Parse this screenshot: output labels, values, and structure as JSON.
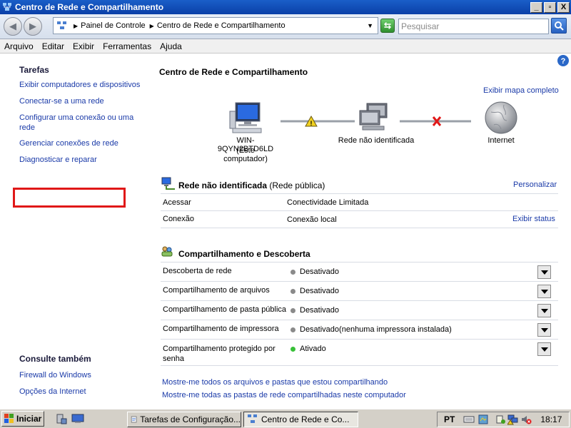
{
  "window": {
    "title": "Centro de Rede e Compartilhamento",
    "minimize": "_",
    "maximize": "▫",
    "close": "X"
  },
  "address": {
    "crumbs": [
      "Painel de Controle",
      "Centro de Rede e Compartilhamento"
    ],
    "search_placeholder": "Pesquisar"
  },
  "menu": [
    "Arquivo",
    "Editar",
    "Exibir",
    "Ferramentas",
    "Ajuda"
  ],
  "left": {
    "tasks_heading": "Tarefas",
    "tasks": [
      "Exibir computadores e dispositivos",
      "Conectar-se a uma rede",
      "Configurar uma conexão ou uma rede",
      "Gerenciar conexões de rede",
      "Diagnosticar e reparar"
    ],
    "see_also_heading": "Consulte também",
    "see_also": [
      "Firewall do Windows",
      "Opções da Internet"
    ]
  },
  "main": {
    "title": "Centro de Rede e Compartilhamento",
    "full_map_link": "Exibir mapa completo",
    "map": {
      "computer_name": "WIN-9QYN2BTD6LD",
      "computer_sub": "(Este computador)",
      "network": "Rede não identificada",
      "internet": "Internet"
    },
    "network_section": {
      "name": "Rede não identificada",
      "type": "(Rede pública)",
      "customize": "Personalizar",
      "rows": [
        {
          "label": "Acessar",
          "value": "Conectividade Limitada",
          "action": ""
        },
        {
          "label": "Conexão",
          "value": "Conexão local",
          "action": "Exibir status"
        }
      ]
    },
    "sharing_section": {
      "title": "Compartilhamento e Descoberta",
      "rows": [
        {
          "label": "Descoberta de rede",
          "value": "Desativado",
          "extra": "",
          "on": false
        },
        {
          "label": "Compartilhamento de arquivos",
          "value": "Desativado",
          "extra": "",
          "on": false
        },
        {
          "label": "Compartilhamento de pasta pública",
          "value": "Desativado",
          "extra": "",
          "on": false
        },
        {
          "label": "Compartilhamento de impressora",
          "value": "Desativado",
          "extra": "(nenhuma impressora instalada)",
          "on": false
        },
        {
          "label": "Compartilhamento protegido por senha",
          "value": "Ativado",
          "extra": "",
          "on": true
        }
      ]
    },
    "bottom_links": [
      "Mostre-me todos os arquivos e pastas que estou compartilhando",
      "Mostre-me todas as pastas de rede compartilhadas neste computador"
    ]
  },
  "taskbar": {
    "start": "Iniciar",
    "tasks": [
      "Tarefas de Configuração...",
      "Centro de Rede e Co..."
    ],
    "lang": "PT",
    "clock": "18:17"
  },
  "colors": {
    "link": "#1a3aa8",
    "title_bar": "#0a3fa8",
    "highlight": "#e01818"
  }
}
